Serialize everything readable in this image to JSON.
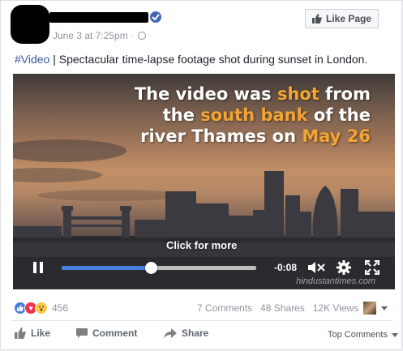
{
  "post": {
    "timestamp": "June 3 at 7:25pm",
    "separator": "·",
    "hashtag": "#Video",
    "caption_rest": " | Spectacular time-lapse footage shot during sunset in London."
  },
  "header": {
    "like_page_label": "Like Page"
  },
  "video": {
    "overlay_line1_a": "The video was ",
    "overlay_line1_hl": "shot",
    "overlay_line1_b": " from",
    "overlay_line2_a": "the ",
    "overlay_line2_hl": "south bank",
    "overlay_line2_b": " of the",
    "overlay_line3_a": "river Thames on ",
    "overlay_line3_hl": "May 26",
    "click_more": "Click for more",
    "time_remaining": "-0:08",
    "progress_fraction": 0.46,
    "watermark": "hindustantimes.com",
    "highlight_color": "#f4a533",
    "progress_color": "#4a7ee0"
  },
  "stats": {
    "reaction_count": "456",
    "comments": "7 Comments",
    "shares": "48 Shares",
    "views": "12K Views",
    "reaction_icons": [
      "like-icon",
      "love-icon",
      "wow-icon"
    ]
  },
  "actions": {
    "like": "Like",
    "comment": "Comment",
    "share": "Share",
    "top_comments": "Top Comments"
  },
  "colors": {
    "brand_blue": "#4267b2",
    "link_blue": "#365899"
  }
}
